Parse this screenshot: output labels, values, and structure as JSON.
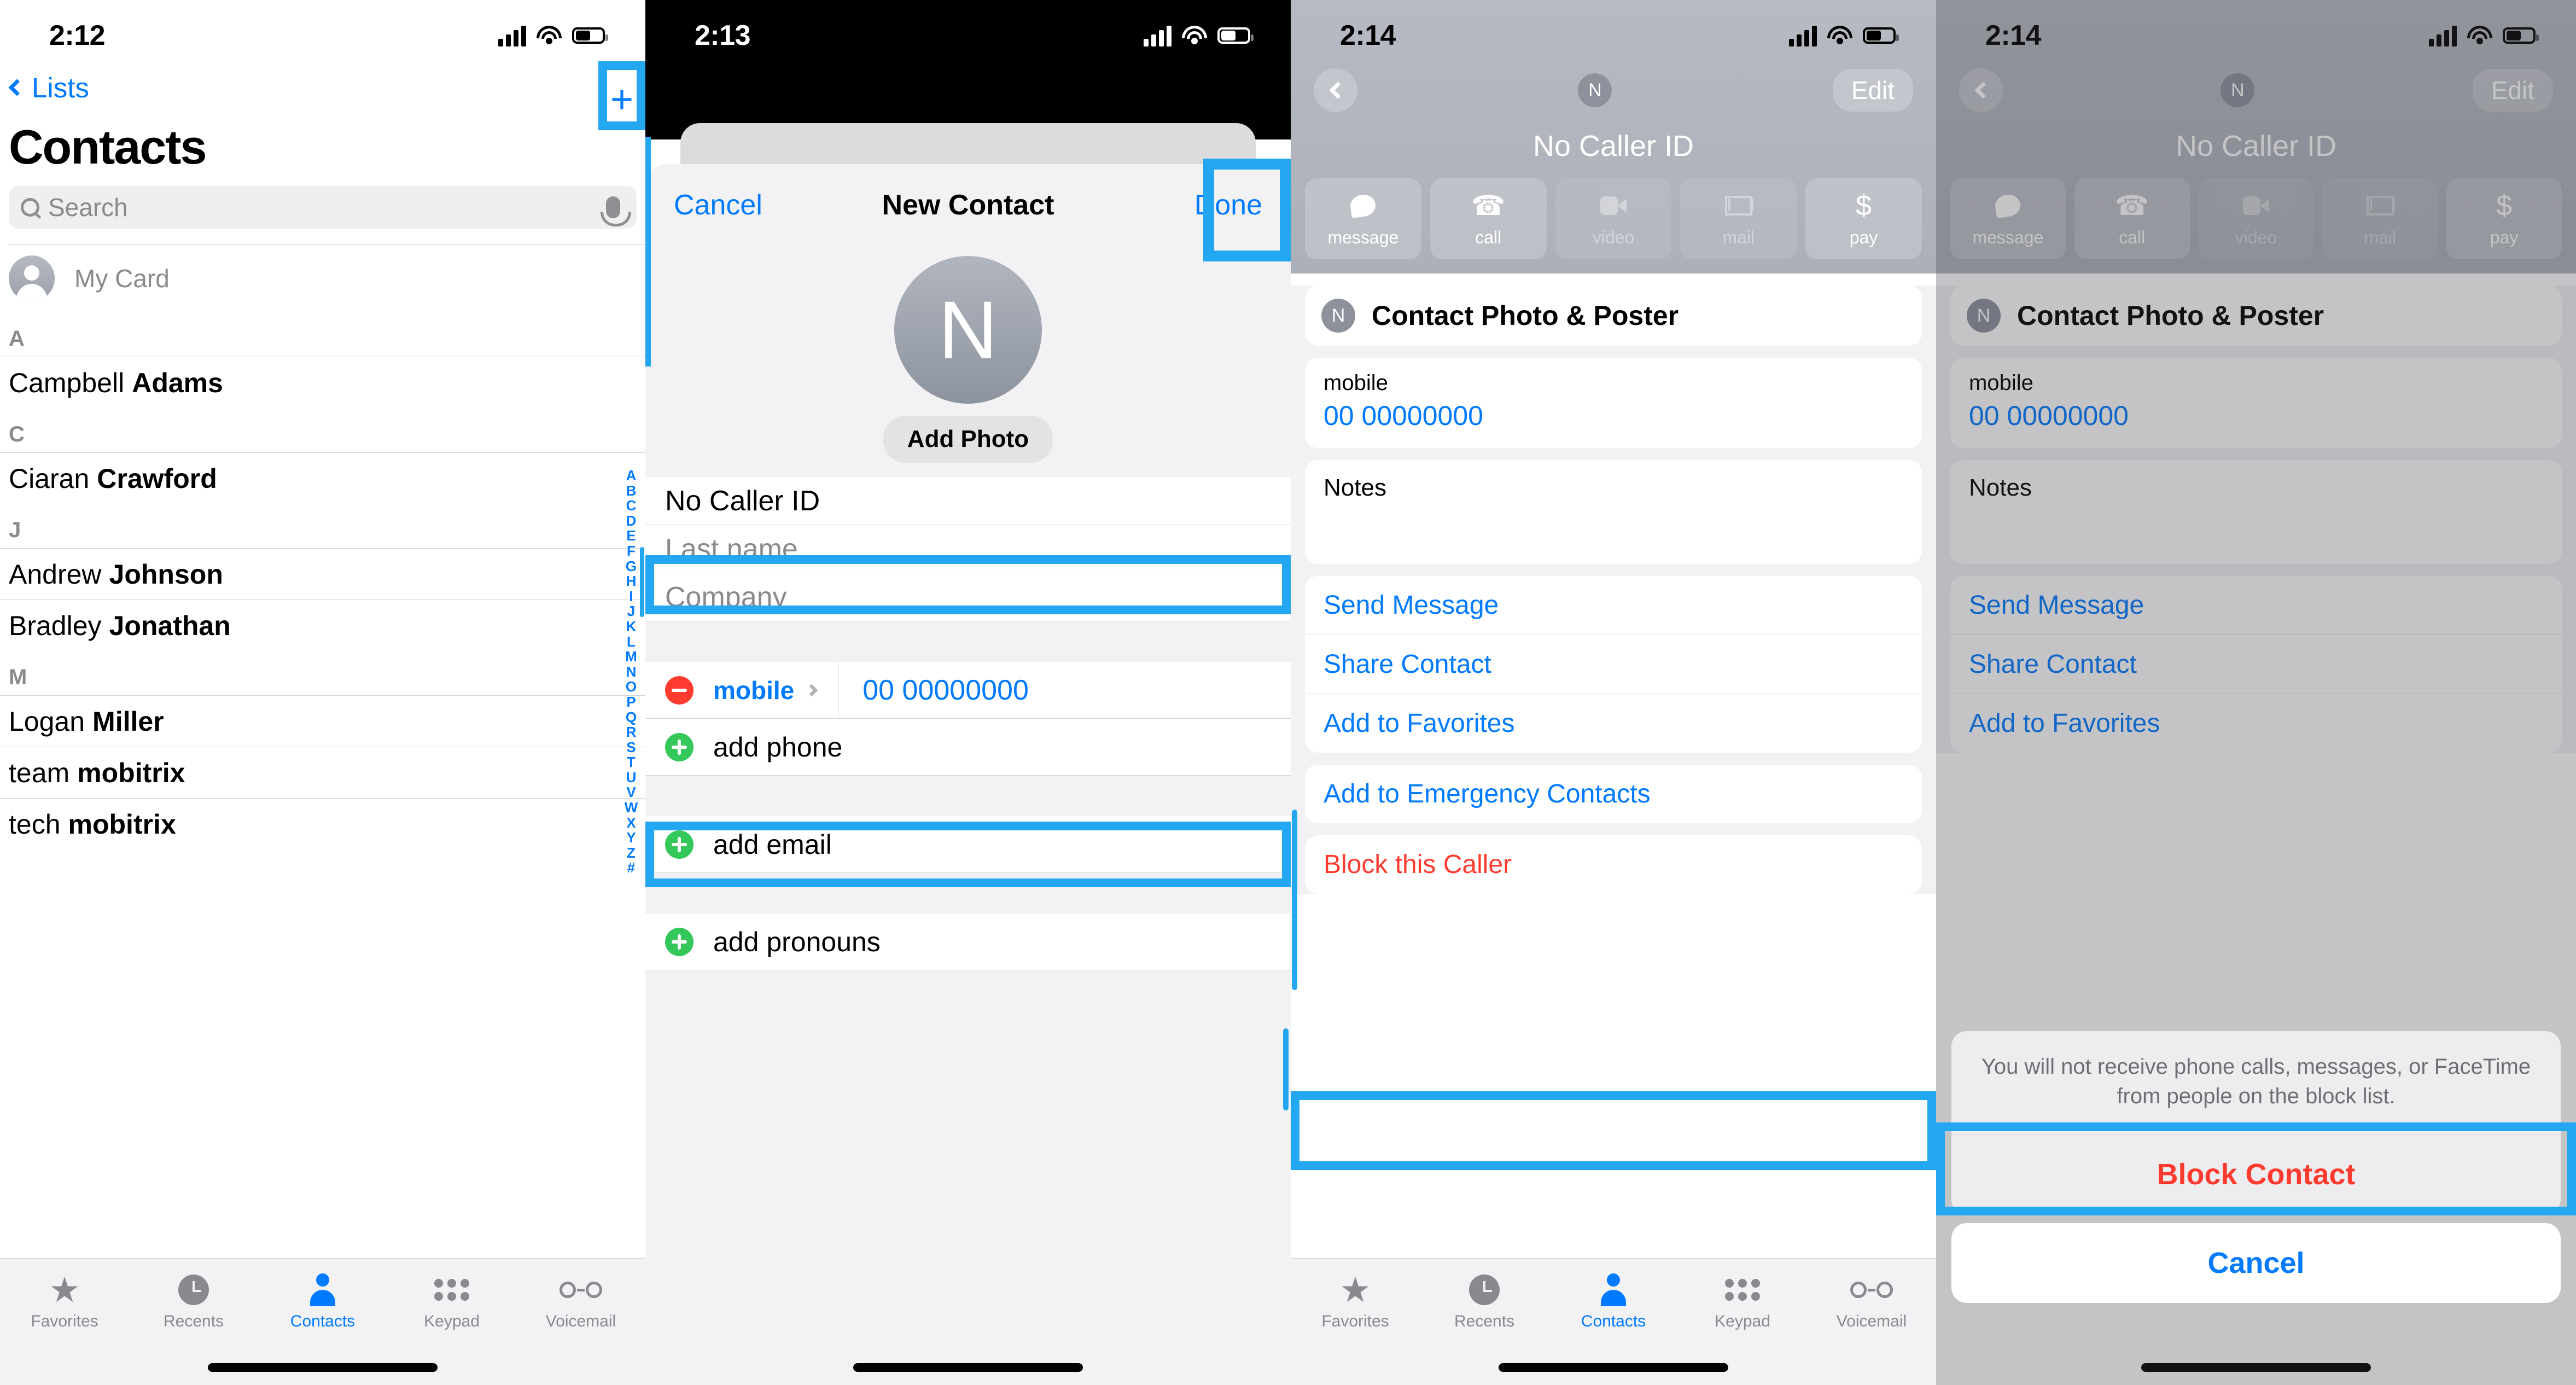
{
  "panel1": {
    "status": {
      "time": "2:12"
    },
    "nav": {
      "back_label": "Lists",
      "add_button": "+"
    },
    "page_title": "Contacts",
    "search": {
      "placeholder": "Search"
    },
    "my_card_label": "My Card",
    "sections": [
      {
        "letter": "A",
        "rows": [
          {
            "first": "Campbell",
            "last": "Adams"
          }
        ]
      },
      {
        "letter": "C",
        "rows": [
          {
            "first": "Ciaran",
            "last": "Crawford"
          }
        ]
      },
      {
        "letter": "J",
        "rows": [
          {
            "first": "Andrew",
            "last": "Johnson"
          },
          {
            "first": "Bradley",
            "last": "Jonathan"
          }
        ]
      },
      {
        "letter": "M",
        "rows": [
          {
            "first": "Logan",
            "last": "Miller"
          },
          {
            "first": "team",
            "last": "mobitrix"
          },
          {
            "first": "tech",
            "last": "mobitrix"
          }
        ]
      }
    ],
    "index": "ABCDEFGHIJKLMNOPQRSTUVWXYZ#",
    "tabs": [
      {
        "label": "Favorites",
        "icon": "star-icon",
        "active": false
      },
      {
        "label": "Recents",
        "icon": "clock-icon",
        "active": false
      },
      {
        "label": "Contacts",
        "icon": "person-icon",
        "active": true
      },
      {
        "label": "Keypad",
        "icon": "keypad-icon",
        "active": false
      },
      {
        "label": "Voicemail",
        "icon": "voicemail-icon",
        "active": false
      }
    ]
  },
  "panel2": {
    "status": {
      "time": "2:13"
    },
    "nav": {
      "cancel": "Cancel",
      "title": "New Contact",
      "done": "Done"
    },
    "avatar_initial": "N",
    "add_photo": "Add Photo",
    "first_name_value": "No Caller ID",
    "last_name_placeholder": "Last name",
    "company_placeholder": "Company",
    "phone": {
      "label": "mobile",
      "number": "00 00000000"
    },
    "add_phone": "add phone",
    "add_email": "add email",
    "add_pronouns": "add pronouns"
  },
  "panel3": {
    "status": {
      "time": "2:14"
    },
    "nav": {
      "edit": "Edit"
    },
    "avatar_initial": "N",
    "contact_name": "No Caller ID",
    "actions": [
      {
        "label": "message",
        "icon": "message-bubble-icon",
        "enabled": true
      },
      {
        "label": "call",
        "icon": "phone-handset-icon",
        "enabled": true
      },
      {
        "label": "video",
        "icon": "video-camera-icon",
        "enabled": false
      },
      {
        "label": "mail",
        "icon": "envelope-icon",
        "enabled": false
      },
      {
        "label": "pay",
        "icon": "dollar-sign-icon",
        "enabled": true
      }
    ],
    "photo_poster": "Contact Photo & Poster",
    "phone": {
      "label": "mobile",
      "number": "00 00000000"
    },
    "notes_label": "Notes",
    "links": [
      "Send Message",
      "Share Contact",
      "Add to Favorites"
    ],
    "emergency_link": "Add to Emergency Contacts",
    "block_link": "Block this Caller",
    "tabs": [
      {
        "label": "Favorites",
        "icon": "star-icon",
        "active": false
      },
      {
        "label": "Recents",
        "icon": "clock-icon",
        "active": false
      },
      {
        "label": "Contacts",
        "icon": "person-icon",
        "active": true
      },
      {
        "label": "Keypad",
        "icon": "keypad-icon",
        "active": false
      },
      {
        "label": "Voicemail",
        "icon": "voicemail-icon",
        "active": false
      }
    ]
  },
  "panel4": {
    "status": {
      "time": "2:14"
    },
    "nav": {
      "edit": "Edit"
    },
    "avatar_initial": "N",
    "contact_name": "No Caller ID",
    "actions": [
      {
        "label": "message",
        "icon": "message-bubble-icon"
      },
      {
        "label": "call",
        "icon": "phone-handset-icon"
      },
      {
        "label": "video",
        "icon": "video-camera-icon"
      },
      {
        "label": "mail",
        "icon": "envelope-icon"
      },
      {
        "label": "pay",
        "icon": "dollar-sign-icon"
      }
    ],
    "photo_poster": "Contact Photo & Poster",
    "phone": {
      "label": "mobile",
      "number": "00 00000000"
    },
    "notes_label": "Notes",
    "links": [
      "Send Message",
      "Share Contact",
      "Add to Favorites"
    ],
    "alert": {
      "message": "You will not receive phone calls, messages, or FaceTime from people on the block list.",
      "confirm": "Block Contact",
      "cancel": "Cancel"
    }
  },
  "colors": {
    "accent": "#007AFF",
    "highlight": "#22A7F0",
    "destructive": "#FF3B30",
    "green": "#34C759",
    "grey_text": "#8A8A8E"
  }
}
